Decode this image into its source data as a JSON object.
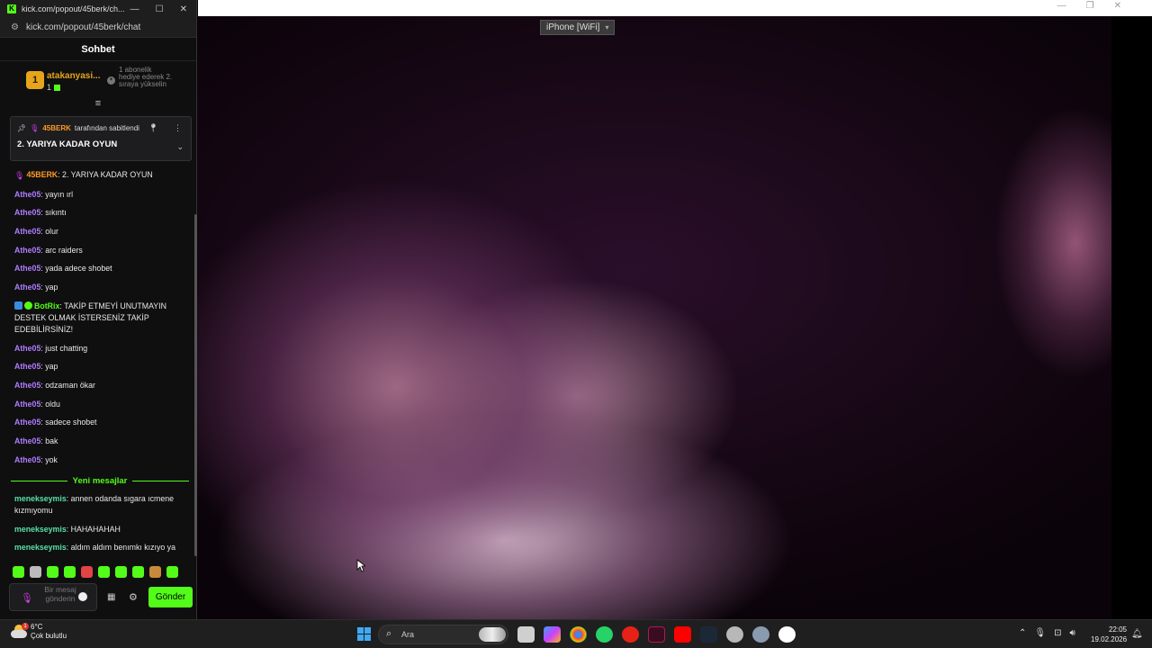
{
  "popout": {
    "window_title": "kick.com/popout/45berk/ch...",
    "url": "kick.com/popout/45berk/chat",
    "chat_title": "Sohbet"
  },
  "leaderboard": {
    "rank": "1",
    "name": "atakanyasi...",
    "count": "1",
    "hint": "1 abonelik hediye ederek 2. sıraya yükselin"
  },
  "pinned": {
    "pinned_by_user": "45BERK",
    "pinned_by_suffix": "tarafından sabitlendi",
    "text": "2. YARIYA KADAR OYUN"
  },
  "messages": [
    {
      "user": "45BERK",
      "color": "orange",
      "badge": "mic",
      "text": "2. YARIYA KADAR OYUN"
    },
    {
      "user": "Athe05",
      "color": "purple",
      "text": "yayın ırl"
    },
    {
      "user": "Athe05",
      "color": "purple",
      "text": "sıkıntı"
    },
    {
      "user": "Athe05",
      "color": "purple",
      "text": "olur"
    },
    {
      "user": "Athe05",
      "color": "purple",
      "text": "arc raiders"
    },
    {
      "user": "Athe05",
      "color": "purple",
      "text": "yada adece shobet"
    },
    {
      "user": "Athe05",
      "color": "purple",
      "text": "yap"
    },
    {
      "user": "BotRix",
      "color": "green",
      "badge": "bot",
      "text": "TAKİP ETMEYİ UNUTMAYIN DESTEK OLMAK İSTERSENİZ TAKİP EDEBİLİRSİNİZ!"
    },
    {
      "user": "Athe05",
      "color": "purple",
      "text": "just chatting"
    },
    {
      "user": "Athe05",
      "color": "purple",
      "text": "yap"
    },
    {
      "user": "Athe05",
      "color": "purple",
      "text": "odzaman ökar"
    },
    {
      "user": "Athe05",
      "color": "purple",
      "text": "oldu"
    },
    {
      "user": "Athe05",
      "color": "purple",
      "text": "sadece shobet"
    },
    {
      "user": "Athe05",
      "color": "purple",
      "text": "bak"
    },
    {
      "user": "Athe05",
      "color": "purple",
      "text": "yok"
    }
  ],
  "new_messages_label": "Yeni mesajlar",
  "new_messages": [
    {
      "user": "menekseymis",
      "color": "teal",
      "text": "annen odanda sıgara ıcmene kızmıyomu"
    },
    {
      "user": "menekseymis",
      "color": "teal",
      "text": "HAHAHAHAH"
    },
    {
      "user": "menekseymis",
      "color": "teal",
      "text": "aldım aldım benımkı kızıyo ya"
    }
  ],
  "input": {
    "placeholder": "Bir mesaj gönderin",
    "send_label": "Gönder"
  },
  "video": {
    "source_label": "iPhone [WiFi]"
  },
  "taskbar": {
    "temperature": "6°C",
    "weather": "Çok bulutlu",
    "weather_alert": "1",
    "search_placeholder": "Ara",
    "time": "22:05",
    "date": "19.02.2026"
  },
  "colors": {
    "kick_green": "#53fc18",
    "username_purple": "#b07cff",
    "username_orange": "#ff9a26",
    "username_teal": "#59e0a4"
  }
}
